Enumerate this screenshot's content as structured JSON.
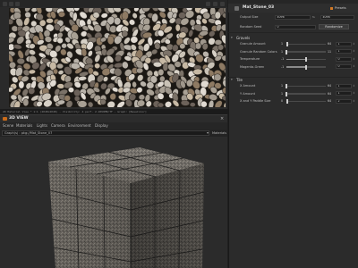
{
  "view2d": {
    "status_text": "2D Material View * 1:1 (2048x2048) - Visibility: 4 perf. 2.2099MB/TF - Graph: [BaseColor]"
  },
  "view3d": {
    "title": "3D VIEW",
    "close": "×",
    "menu": [
      "Scene",
      "Materials",
      "Lights",
      "Camera",
      "Environment",
      "Display"
    ],
    "graph_select": "Graph(s) : pkg://Mat_Stone_07",
    "materials_button": "Materials"
  },
  "panel": {
    "title": "Mat_Stone_03",
    "presets_label": "Presets",
    "output_size_label": "Output Size",
    "output_size_w": "4096",
    "output_size_link": "⇆",
    "output_size_h": "4096",
    "random_seed_label": "Random Seed",
    "random_seed_value": "0",
    "randomize_label": "Randomize",
    "sections": {
      "gravels": {
        "title": "Gravels",
        "rows": [
          {
            "label": "Granule Amount",
            "min": "1",
            "max": "64",
            "value": "1",
            "level": 0.02
          },
          {
            "label": "Granule Random Colors",
            "min": "1",
            "max": "11",
            "value": "1",
            "level": 0.0
          },
          {
            "label": "Temperature",
            "min": "-1",
            "max": "",
            "value": "0",
            "level": 0.5
          },
          {
            "label": "Magenta-Green",
            "min": "-1",
            "max": "",
            "value": "0",
            "level": 0.5
          }
        ]
      },
      "tile": {
        "title": "Tile",
        "rows": [
          {
            "label": "X Amount",
            "min": "1",
            "max": "64",
            "value": "1",
            "level": 0.0
          },
          {
            "label": "Y Amount",
            "min": "1",
            "max": "64",
            "value": "1",
            "level": 0.0
          },
          {
            "label": "X and Y Paddle Size",
            "min": "0",
            "max": "64",
            "value": "2",
            "level": 0.03
          }
        ]
      }
    }
  },
  "colors": {
    "accent": "#d47a25",
    "panel_bg": "#2b2b2b",
    "viewport_bg": "#2b2b2b"
  }
}
